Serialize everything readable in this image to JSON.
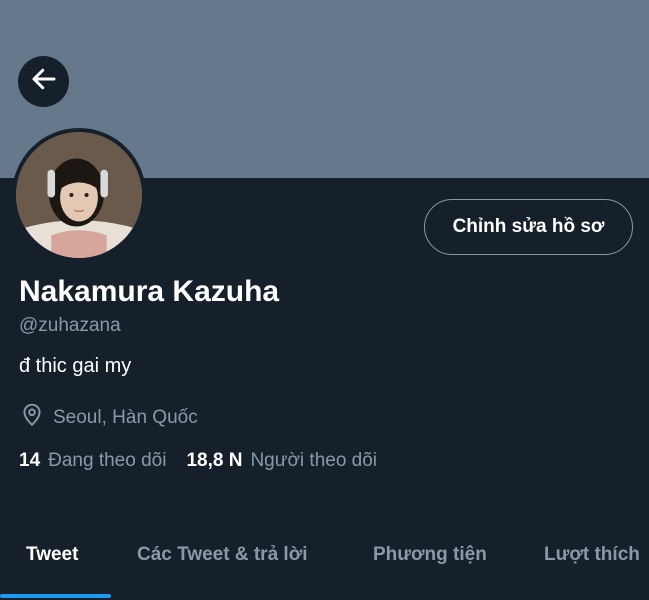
{
  "profile": {
    "display_name": "Nakamura Kazuha",
    "handle": "@zuhazana",
    "bio": "đ thic gai my",
    "location": "Seoul, Hàn Quốc",
    "following_count": "14",
    "following_label": "Đang theo dõi",
    "followers_count": "18,8 N",
    "followers_label": "Người theo dõi"
  },
  "actions": {
    "edit_profile_label": "Chỉnh sửa hồ sơ"
  },
  "icons": {
    "back": "arrow-left-icon",
    "location": "map-pin-icon"
  },
  "tabs": [
    {
      "label": "Tweet",
      "active": true
    },
    {
      "label": "Các Tweet & trả lời",
      "active": false
    },
    {
      "label": "Phương tiện",
      "active": false
    },
    {
      "label": "Lượt thích",
      "active": false
    }
  ],
  "colors": {
    "background": "#15202b",
    "banner": "#66798c",
    "accent": "#1d9bf0",
    "secondary_text": "#8b98a5"
  }
}
